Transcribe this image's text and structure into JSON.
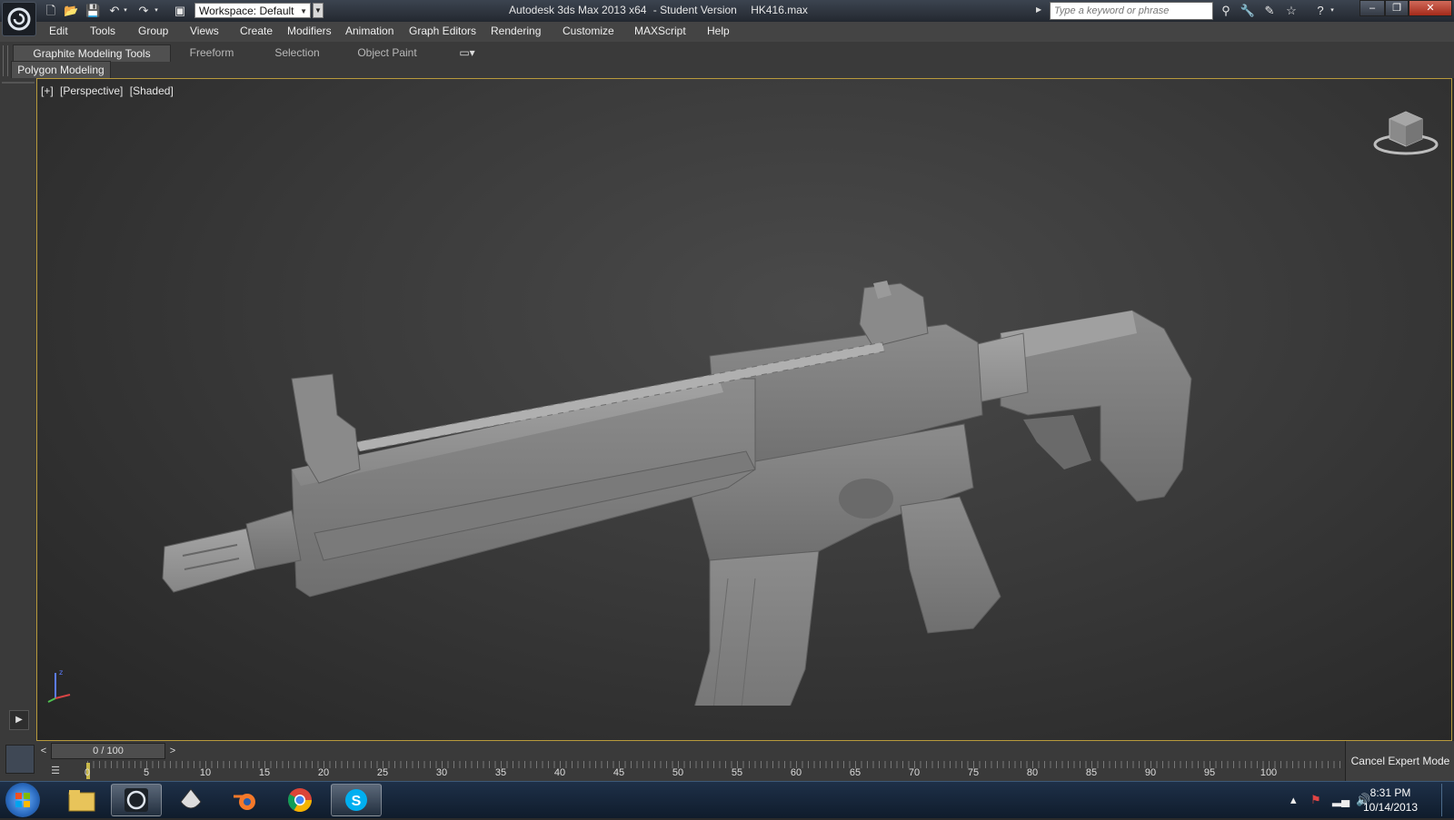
{
  "titlebar": {
    "workspace_label": "Workspace: Default",
    "app_title": "Autodesk 3ds Max  2013 x64",
    "edition": "- Student Version",
    "file_name": "HK416.max",
    "search_placeholder": "Type a keyword or phrase",
    "minimize": "–",
    "restore": "❐",
    "close": "✕"
  },
  "menubar": {
    "items": [
      "Edit",
      "Tools",
      "Group",
      "Views",
      "Create",
      "Modifiers",
      "Animation",
      "Graph Editors",
      "Rendering",
      "Customize",
      "MAXScript",
      "Help"
    ]
  },
  "ribbon": {
    "tabs": [
      "Graphite Modeling Tools",
      "Freeform",
      "Selection",
      "Object Paint"
    ],
    "panel": "Polygon Modeling"
  },
  "viewport": {
    "label_plus": "[+]",
    "label_view": "[Perspective]",
    "label_shading": "[Shaded]",
    "gizmo_z": "z"
  },
  "timeline": {
    "frame_display": "0 / 100",
    "prev": "<",
    "next": ">",
    "ticks": [
      "0",
      "5",
      "10",
      "15",
      "20",
      "25",
      "30",
      "35",
      "40",
      "45",
      "50",
      "55",
      "60",
      "65",
      "70",
      "75",
      "80",
      "85",
      "90",
      "95",
      "100"
    ],
    "cancel_expert": "Cancel Expert Mode"
  },
  "taskbar": {
    "time": "8:31 PM",
    "date": "10/14/2013",
    "apps": [
      "windows-explorer",
      "3ds-max",
      "inkscape",
      "blender",
      "chrome",
      "skype"
    ]
  },
  "colors": {
    "viewport_border": "#b89a3c",
    "model_grey": "#8e8e8e",
    "ui_dark": "#3a3a3a"
  }
}
